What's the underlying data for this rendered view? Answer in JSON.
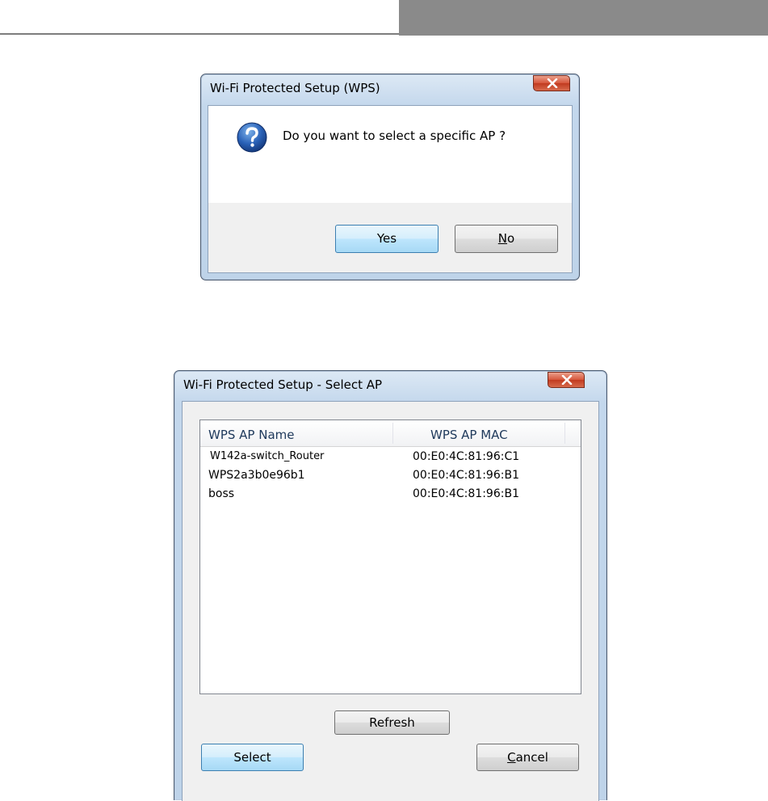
{
  "dialog_confirm": {
    "title": "Wi-Fi Protected Setup (WPS)",
    "message": "Do you want to select a specific AP ?",
    "yes_label": "Yes",
    "no_mnemonic": "N",
    "no_rest": "o",
    "icon": "question-icon"
  },
  "dialog_select": {
    "title": "Wi-Fi Protected Setup - Select AP",
    "columns": [
      "WPS AP Name",
      "WPS AP MAC"
    ],
    "rows": [
      {
        "name": "W142a-switch_Router",
        "mac": "00:E0:4C:81:96:C1"
      },
      {
        "name": "WPS2a3b0e96b1",
        "mac": "00:E0:4C:81:96:B1"
      },
      {
        "name": "boss",
        "mac": "00:E0:4C:81:96:B1"
      }
    ],
    "refresh_label": "Refresh",
    "select_label": "Select",
    "cancel_mnemonic": "C",
    "cancel_rest": "ancel"
  },
  "colors": {
    "accent": "#3c7fb1",
    "close_button": "#c13a1f"
  }
}
